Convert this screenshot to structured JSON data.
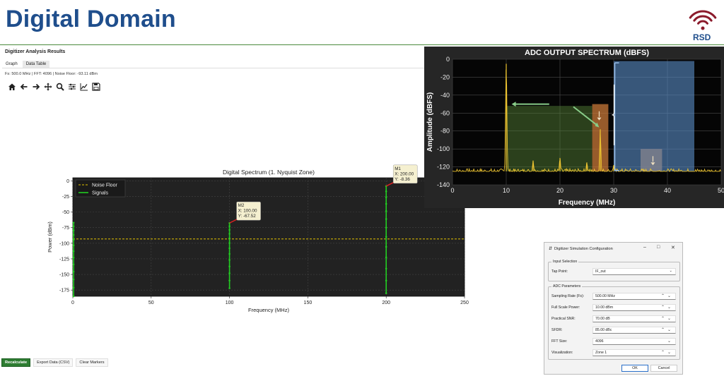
{
  "slide": {
    "title": "Digital Domain",
    "logo_text": "RSD",
    "logo_icon": "wifi-signal-icon",
    "logo_color": "#8b1a2b"
  },
  "app": {
    "title": "Digitizer Analysis Results",
    "tabs": [
      {
        "label": "Graph",
        "active": true
      },
      {
        "label": "Data Table",
        "active": false
      }
    ],
    "info": "Fs: 500.0 MHz | FFT: 4096 | Noise Floor: -93.11 dBm",
    "toolbar_icons": [
      "home-icon",
      "back-arrow-icon",
      "forward-arrow-icon",
      "pan-icon",
      "zoom-icon",
      "configure-icon",
      "line-chart-icon",
      "save-icon"
    ],
    "buttons": {
      "recalculate": "Recalculate",
      "export": "Export Data (CSV)",
      "clear": "Clear Markers"
    }
  },
  "chart_data": [
    {
      "type": "line",
      "title": "Digital Spectrum (1. Nyquist Zone)",
      "xlabel": "Frequency (MHz)",
      "ylabel": "Power (dBm)",
      "xlim": [
        0,
        250
      ],
      "ylim": [
        -185,
        5
      ],
      "xticks": [
        0,
        50,
        100,
        150,
        200,
        250
      ],
      "yticks": [
        0,
        -25,
        -50,
        -75,
        -100,
        -125,
        -150,
        -175
      ],
      "grid": true,
      "legend_placement": "top-left",
      "noise_floor": -93.11,
      "series": [
        {
          "name": "Noise Floor",
          "color": "#e0c000",
          "style": "dashed"
        },
        {
          "name": "Signals",
          "color": "#22cc22",
          "spikes": [
            {
              "x": 0.5,
              "peak": -67,
              "bottom": -185
            },
            {
              "x": 100,
              "peak": -67.52,
              "bottom": -172
            },
            {
              "x": 200,
              "peak": -8.36,
              "bottom": -180
            }
          ]
        }
      ],
      "markers": [
        {
          "label": "M2",
          "x_text": "X: 100.00",
          "y_text": "Y: -67.52",
          "x": 100,
          "y": -67.52
        },
        {
          "label": "M1",
          "x_text": "X: 200.00",
          "y_text": "Y: -8.36",
          "x": 200,
          "y": -8.36
        }
      ]
    },
    {
      "type": "line",
      "title": "ADC OUTPUT SPECTRUM (dBFS)",
      "xlabel": "Frequency (MHz)",
      "ylabel": "Amplitude (dBFS)",
      "xlim": [
        0,
        50
      ],
      "ylim": [
        -140,
        0
      ],
      "xticks": [
        0,
        10,
        20,
        30,
        40,
        50
      ],
      "yticks": [
        0,
        -20,
        -40,
        -60,
        -80,
        -100,
        -120,
        -140
      ],
      "grid": true,
      "noise_level": -125,
      "peaks": [
        {
          "x": 10,
          "y": -5
        },
        {
          "x": 15,
          "y": -113
        },
        {
          "x": 20,
          "y": -110
        },
        {
          "x": 25,
          "y": -115
        },
        {
          "x": 27.5,
          "y": -78
        },
        {
          "x": 30,
          "y": -118
        }
      ],
      "colors": {
        "trace": "#e8c030",
        "green_region": "#5a8a3a",
        "orange_region": "#c87838",
        "blue_region": "#5a8ec8"
      },
      "regions": [
        {
          "color": "green",
          "x": [
            10,
            26
          ],
          "y": [
            -52,
            -125
          ]
        },
        {
          "color": "orange",
          "x": [
            26,
            29
          ],
          "y": [
            -50,
            -125
          ]
        },
        {
          "color": "orange",
          "x": [
            35,
            39
          ],
          "y": [
            -100,
            -125
          ]
        },
        {
          "color": "blue",
          "x": [
            30,
            45
          ],
          "y": [
            -2,
            -125
          ]
        }
      ]
    }
  ],
  "dialog": {
    "title": "Digitizer Simulation Configuration",
    "input_group": "Input Selection",
    "tap_label": "Tap Point:",
    "tap_value": "IF_out",
    "adc_group": "ADC Parameters",
    "params": [
      {
        "label": "Sampling Rate (Fs):",
        "value": "500.00 MHz",
        "kind": "spin"
      },
      {
        "label": "Full Scale Power:",
        "value": "10.00 dBm",
        "kind": "spin"
      },
      {
        "label": "Practical SNR:",
        "value": "70.00 dB",
        "kind": "spin"
      },
      {
        "label": "SFDR:",
        "value": "85.00 dBc",
        "kind": "spin"
      },
      {
        "label": "FFT Size:",
        "value": "4096",
        "kind": "select"
      },
      {
        "label": "Visualization:",
        "value": "Zone 1",
        "kind": "spin"
      }
    ],
    "ok": "OK",
    "cancel": "Cancel"
  }
}
